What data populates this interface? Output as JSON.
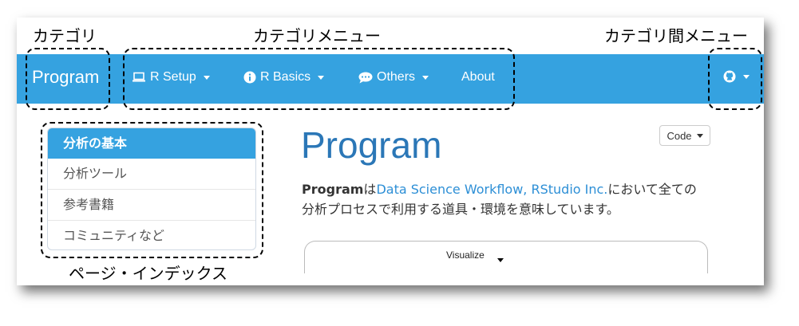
{
  "callouts": {
    "category": "カテゴリ",
    "category_menu": "カテゴリメニュー",
    "inter_category_menu": "カテゴリ間メニュー",
    "page_index": "ページ・インデックス"
  },
  "navbar": {
    "brand": "Program",
    "items": [
      {
        "label": "R Setup",
        "icon": "laptop-icon"
      },
      {
        "label": "R Basics",
        "icon": "info-circle-icon"
      },
      {
        "label": "Others",
        "icon": "comment-icon"
      },
      {
        "label": "About"
      }
    ],
    "right_icon": "github-icon",
    "accent": "#35a2e0"
  },
  "sidebar": {
    "items": [
      {
        "label": "分析の基本",
        "active": true
      },
      {
        "label": "分析ツール"
      },
      {
        "label": "参考書籍"
      },
      {
        "label": "コミュニティなど"
      }
    ]
  },
  "main": {
    "title": "Program",
    "code_button": "Code",
    "text_bold": "Program",
    "text_1": "は",
    "text_link": "Data Science Workflow, RStudio Inc.",
    "text_2": "において全ての",
    "text_line2": "分析プロセスで利用する道具・環境を意味しています。",
    "panel_label": "Visualize"
  }
}
